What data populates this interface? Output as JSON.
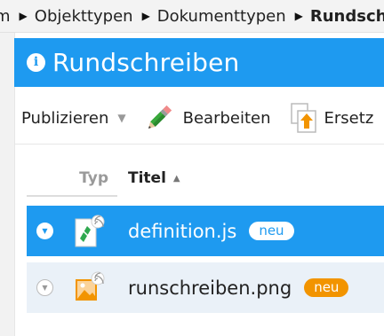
{
  "breadcrumb": {
    "items": [
      {
        "label": "m",
        "current": false
      },
      {
        "label": "Objekttypen",
        "current": false
      },
      {
        "label": "Dokumenttypen",
        "current": false
      },
      {
        "label": "Rundschreiben",
        "current": true
      }
    ]
  },
  "header": {
    "title": "Rundschreiben",
    "accent_color": "#1e9af0"
  },
  "toolbar": {
    "publish_label": "Publizieren",
    "edit_label": "Bearbeiten",
    "replace_label": "Ersetz"
  },
  "table": {
    "columns": {
      "type": "Typ",
      "title": "Titel"
    },
    "rows": [
      {
        "name": "definition.js",
        "badge": "neu",
        "icon": "js-file-icon",
        "selected": true
      },
      {
        "name": "runschreiben.png",
        "badge": "neu",
        "icon": "image-file-icon",
        "selected": false
      }
    ],
    "badge_colors": {
      "selected": "#ffffff",
      "normal": "#f29400"
    }
  }
}
